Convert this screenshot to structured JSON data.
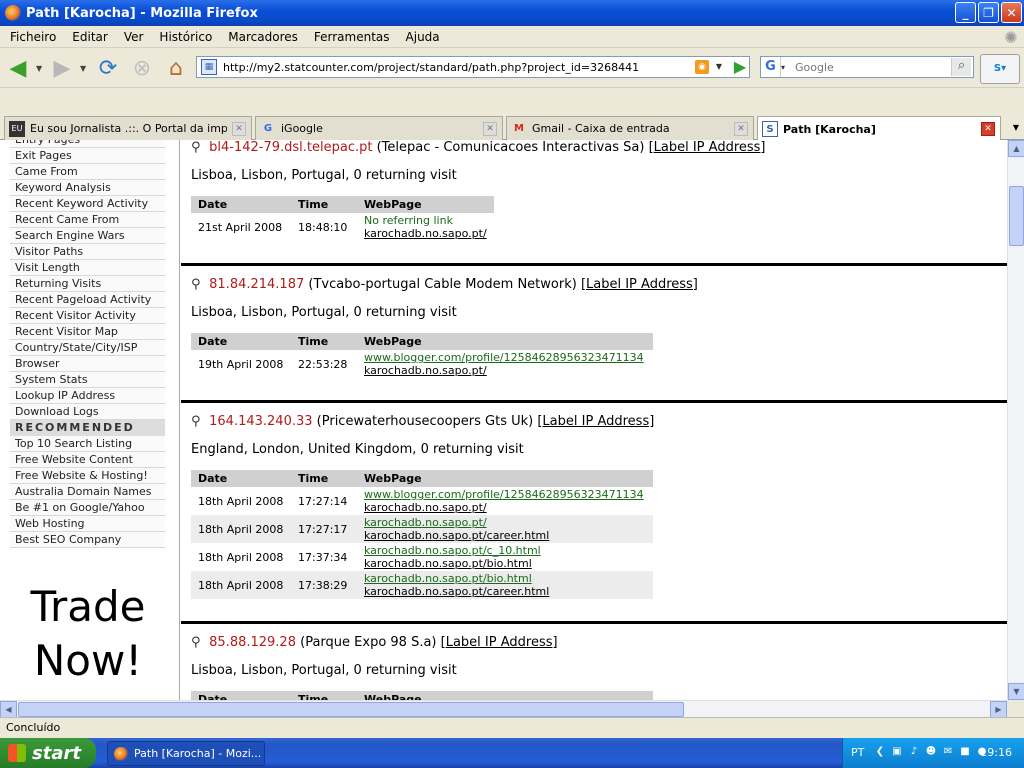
{
  "window": {
    "title": "Path [Karocha] - Mozilla Firefox"
  },
  "menu": [
    "Ficheiro",
    "Editar",
    "Ver",
    "Histórico",
    "Marcadores",
    "Ferramentas",
    "Ajuda"
  ],
  "nav": {
    "url": "http://my2.statcounter.com/project/standard/path.php?project_id=3268441",
    "search_placeholder": "Google"
  },
  "tabs": [
    {
      "label": "Eu sou Jornalista .::. O Portal da impr...",
      "favicon": "EU"
    },
    {
      "label": "iGoogle",
      "favicon": "G"
    },
    {
      "label": "Gmail - Caixa de entrada",
      "favicon": "M"
    },
    {
      "label": "Path [Karocha]",
      "favicon": "S"
    }
  ],
  "sidebar": {
    "items": [
      "Entry Pages",
      "Exit Pages",
      "Came From",
      "Keyword Analysis",
      "Recent Keyword Activity",
      "Recent Came From",
      "Search Engine Wars",
      "Visitor Paths",
      "Visit Length",
      "Returning Visits",
      "Recent Pageload Activity",
      "Recent Visitor Activity",
      "Recent Visitor Map",
      "Country/State/City/ISP",
      "Browser",
      "System Stats",
      "Lookup IP Address",
      "Download Logs"
    ],
    "recommended_header": "RECOMMENDED",
    "recommended": [
      "Top 10 Search Listing",
      "Free Website Content",
      "Free Website & Hosting!",
      "Australia Domain Names",
      "Be #1 on Google/Yahoo",
      "Web Hosting",
      "Best SEO Company"
    ],
    "ad_line1": "Trade",
    "ad_line2": "Now!"
  },
  "table_headers": {
    "date": "Date",
    "time": "Time",
    "webpage": "WebPage"
  },
  "label_ip": "[Label IP Address]",
  "entries": [
    {
      "ip": "bl4-142-79.dsl.telepac.pt",
      "isp": "(Telepac - Comunicacoes Interactivas Sa)",
      "location": "Lisboa, Lisbon, Portugal, 0 returning visit",
      "rows": [
        {
          "date": "21st April 2008",
          "time": "18:48:10",
          "from": "No referring link",
          "page": "karochadb.no.sapo.pt/"
        }
      ]
    },
    {
      "ip": "81.84.214.187",
      "isp": "(Tvcabo-portugal Cable Modem Network)",
      "location": "Lisboa, Lisbon, Portugal, 0 returning visit",
      "rows": [
        {
          "date": "19th April 2008",
          "time": "22:53:28",
          "from": "www.blogger.com/profile/12584628956323471134",
          "page": "karochadb.no.sapo.pt/"
        }
      ]
    },
    {
      "ip": "164.143.240.33",
      "isp": "(Pricewaterhousecoopers Gts Uk)",
      "location": "England, London, United Kingdom, 0 returning visit",
      "rows": [
        {
          "date": "18th April 2008",
          "time": "17:27:14",
          "from": "www.blogger.com/profile/12584628956323471134",
          "page": "karochadb.no.sapo.pt/"
        },
        {
          "date": "18th April 2008",
          "time": "17:27:17",
          "from": "karochadb.no.sapo.pt/",
          "page": "karochadb.no.sapo.pt/career.html"
        },
        {
          "date": "18th April 2008",
          "time": "17:37:34",
          "from": "karochadb.no.sapo.pt/c_10.html",
          "page": "karochadb.no.sapo.pt/bio.html"
        },
        {
          "date": "18th April 2008",
          "time": "17:38:29",
          "from": "karochadb.no.sapo.pt/bio.html",
          "page": "karochadb.no.sapo.pt/career.html"
        }
      ]
    },
    {
      "ip": "85.88.129.28",
      "isp": "(Parque Expo 98 S.a)",
      "location": "Lisboa, Lisbon, Portugal, 0 returning visit",
      "rows": []
    }
  ],
  "status": "Concluído",
  "taskbar": {
    "start": "start",
    "task": "Path [Karocha] - Mozi...",
    "lang": "PT",
    "clock": "19:16"
  }
}
